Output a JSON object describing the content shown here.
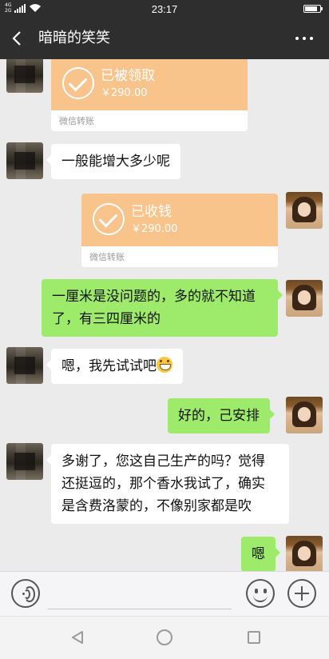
{
  "status_bar": {
    "signal_label_top": "4G",
    "signal_label_bottom": "2G",
    "time": "23:17",
    "battery_level": 0.85
  },
  "header": {
    "title": "暗暗的笑笑"
  },
  "messages": [
    {
      "type": "transfer",
      "side": "left",
      "status": "已被领取",
      "amount": "￥290.00",
      "label": "微信转账"
    },
    {
      "type": "text",
      "side": "left",
      "text": "一般能增大多少呢"
    },
    {
      "type": "transfer",
      "side": "right",
      "status": "已收钱",
      "amount": "￥290.00",
      "label": "微信转账"
    },
    {
      "type": "text",
      "side": "right",
      "lines": [
        "一厘米是没问题的，多的就不知道",
        "了，有三四厘米的"
      ]
    },
    {
      "type": "text",
      "side": "left",
      "text": "嗯，我先试试吧",
      "emoji": "grin-emoji"
    },
    {
      "type": "text",
      "side": "right",
      "text": "好的，己安排"
    },
    {
      "type": "text",
      "side": "left",
      "lines": [
        "多谢了，您这自己生产的吗？觉得",
        "还挺逗的，那个香水我试了，确实",
        "是含费洛蒙的，不像别家都是吹"
      ]
    },
    {
      "type": "text",
      "side": "right",
      "text": "嗯"
    }
  ],
  "input_bar": {
    "voice_icon": "voice-icon",
    "emoji_icon": "emoji-icon",
    "plus_icon": "plus-icon"
  },
  "system_nav": {
    "back_icon": "triangle-back-icon",
    "home_icon": "circle-home-icon",
    "recent_icon": "square-recent-icon"
  },
  "colors": {
    "header_bg": "#2e2e2e",
    "chat_bg": "#ebebeb",
    "green_bubble": "#9eea6a",
    "transfer_orange": "#f9c38c"
  }
}
